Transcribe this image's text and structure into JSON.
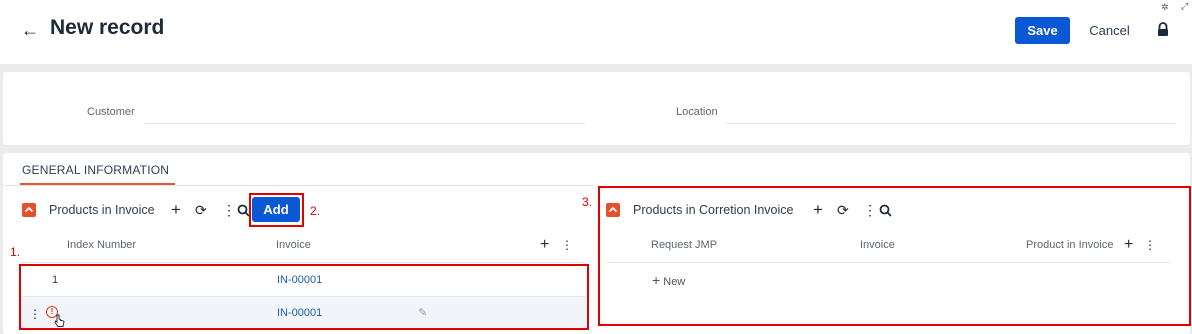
{
  "header": {
    "title": "New record",
    "save_label": "Save",
    "cancel_label": "Cancel",
    "back_icon": "arrow-left-icon",
    "lock_icon": "lock-icon"
  },
  "record_fields": {
    "customer_label": "Customer",
    "location_label": "Location"
  },
  "tabs": {
    "general": "GENERAL INFORMATION"
  },
  "products_in_invoice": {
    "title": "Products in Invoice",
    "add_label": "Add",
    "columns": [
      "Index Number",
      "Invoice"
    ],
    "rows": [
      {
        "index": "1",
        "invoice": "IN-00001"
      },
      {
        "index": "",
        "invoice": "IN-00001"
      }
    ]
  },
  "products_in_correction": {
    "title": "Products in Corretion Invoice",
    "columns": [
      "Request JMP",
      "Invoice",
      "Product in Invoice"
    ],
    "new_label": "New"
  },
  "annotations": {
    "one": "1.",
    "two": "2.",
    "three": "3."
  },
  "colors": {
    "accent_blue": "#0a58d6",
    "collapse_orange": "#e4502b",
    "annotation_red": "#e00000",
    "link_blue": "#1f5ea8"
  }
}
